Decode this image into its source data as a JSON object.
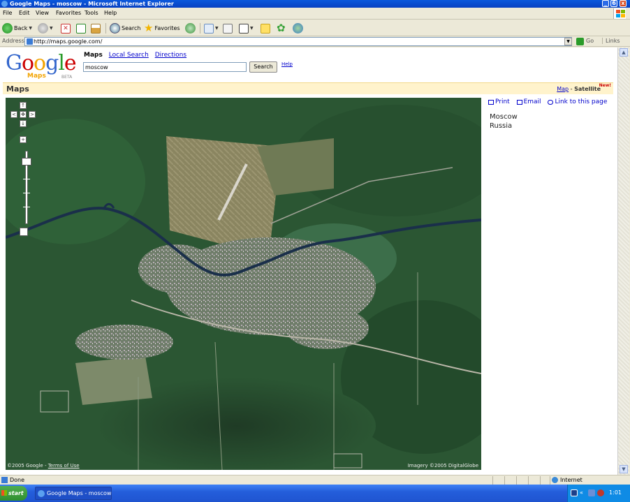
{
  "window": {
    "title": "Google Maps - moscow - Microsoft Internet Explorer",
    "controls": [
      "_",
      "6",
      "x"
    ]
  },
  "menu": {
    "items": [
      "File",
      "Edit",
      "View",
      "Favorites",
      "Tools",
      "Help"
    ]
  },
  "toolbar": {
    "back_label": "Back",
    "search_label": "Search",
    "favorites_label": "Favorites"
  },
  "address": {
    "label": "Address",
    "url": "http://maps.google.com/",
    "go_label": "Go",
    "links_label": "Links"
  },
  "google": {
    "logo_text": "Google",
    "logo_sub": "Maps",
    "logo_beta": "BETA",
    "tabs": {
      "maps": "Maps",
      "local_search": "Local Search",
      "directions": "Directions"
    },
    "search_value": "moscow",
    "search_button": "Search",
    "help_link": "Help"
  },
  "maps_band": {
    "title": "Maps",
    "map_link": "Map",
    "separator": " - ",
    "satellite": "Satellite",
    "new_badge": "New!"
  },
  "map": {
    "copyright_left": "©2005 Google - ",
    "terms_link": "Terms of Use",
    "copyright_right": "Imagery ©2005 DigitalGlobe",
    "controls": {
      "up": "↑",
      "left": "<",
      "center": "✥",
      "right": ">",
      "down": "↓",
      "zoom_in": "+"
    }
  },
  "side_panel": {
    "print": "Print",
    "email": "Email",
    "link": "Link to this page",
    "result_line1": "Moscow",
    "result_line2": "Russia"
  },
  "status": {
    "text": "Done",
    "zone": "Internet"
  },
  "taskbar": {
    "start": "start",
    "task_item": "Google Maps - moscow...",
    "clock": "1:01"
  },
  "colors": {
    "titlebar": "#0a58dc",
    "maps_band_bg": "#fff3cc",
    "link": "#0000cc",
    "forest": "#2b5633",
    "taskbar": "#245edb"
  }
}
